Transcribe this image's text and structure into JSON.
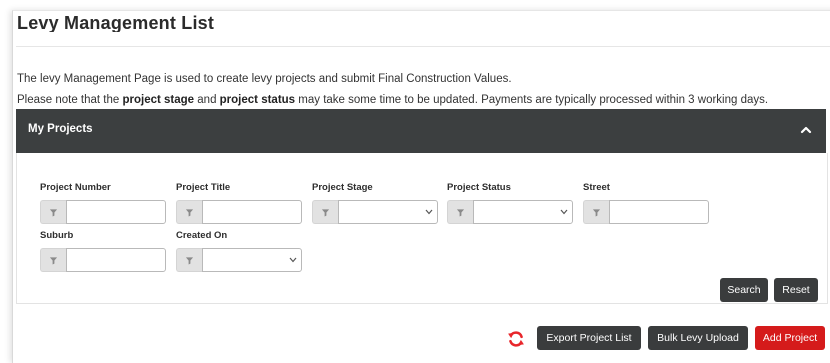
{
  "page": {
    "title": "Levy Management List",
    "intro_line1": "The levy Management Page is used to create levy projects and submit Final Construction Values.",
    "intro_line2_before": "Please note that the ",
    "intro_line2_bold1": "project stage",
    "intro_line2_mid": " and ",
    "intro_line2_bold2": "project status",
    "intro_line2_after": " may take some time to be updated. Payments are typically processed within 3 working days."
  },
  "panel": {
    "title": "My Projects",
    "collapsed": false
  },
  "filters": {
    "project_number": {
      "label": "Project Number",
      "value": ""
    },
    "project_title": {
      "label": "Project Title",
      "value": ""
    },
    "project_stage": {
      "label": "Project Stage",
      "selected": ""
    },
    "project_status": {
      "label": "Project Status",
      "selected": ""
    },
    "street": {
      "label": "Street",
      "value": ""
    },
    "suburb": {
      "label": "Suburb",
      "value": ""
    },
    "created_on": {
      "label": "Created On",
      "selected": ""
    }
  },
  "buttons": {
    "search": "Search",
    "reset": "Reset",
    "export": "Export Project List",
    "bulk_upload": "Bulk Levy Upload",
    "add_project": "Add Project"
  },
  "icons": {
    "filter": "filter-icon",
    "chevron": "chevron-down-icon",
    "collapse": "chevron-up-icon",
    "refresh": "refresh-icon"
  },
  "colors": {
    "panel_header": "#3c3f40",
    "button_dark": "#3a3c3d",
    "button_primary": "#d51b1b",
    "refresh_icon": "#e8262b"
  }
}
